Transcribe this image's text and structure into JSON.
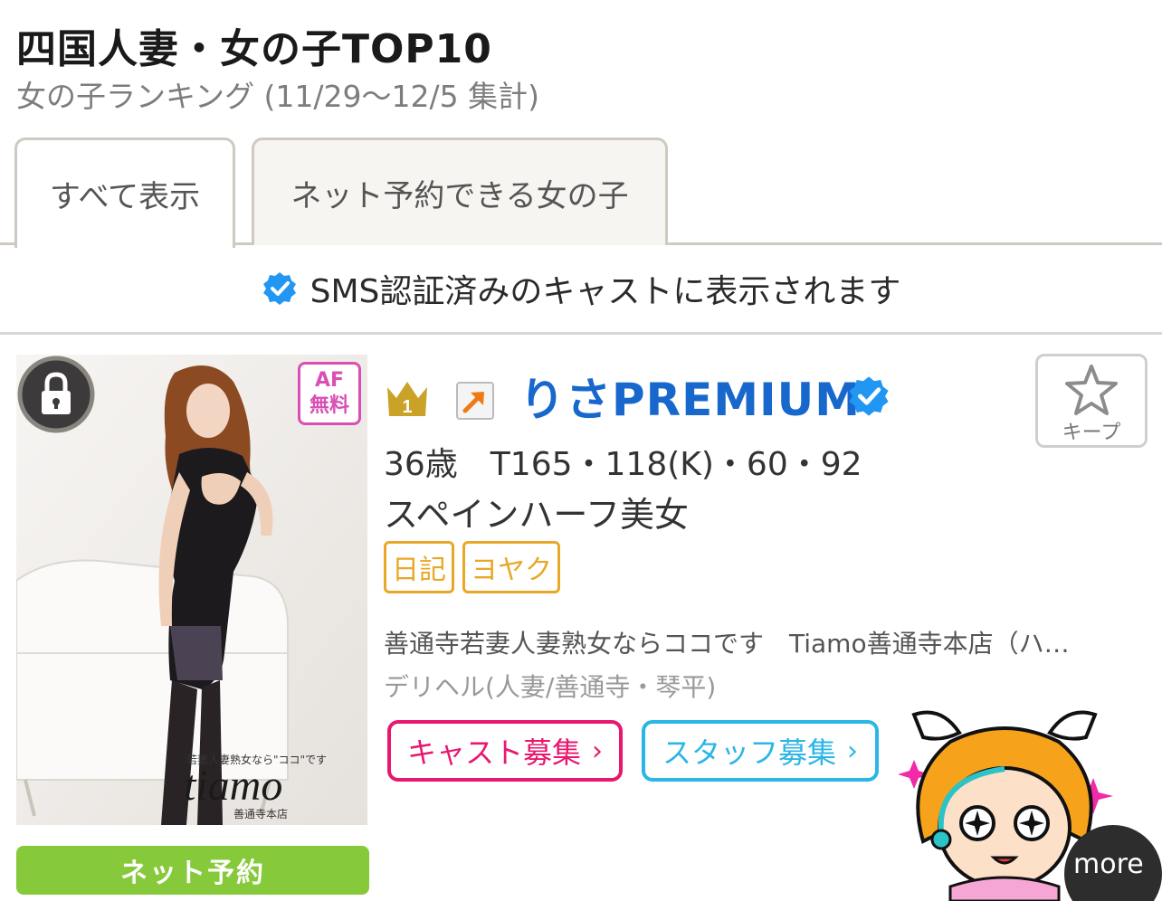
{
  "header": {
    "title": "四国人妻・女の子TOP10",
    "subtitle": "女の子ランキング (11/29〜12/5 集計)"
  },
  "tabs": [
    {
      "label": "すべて表示",
      "active": true
    },
    {
      "label": "ネット予約できる女の子",
      "active": false
    }
  ],
  "sms_note": "SMS認証済みのキャストに表示されます",
  "cast": {
    "rank": "1",
    "name": "りさPREMIUM",
    "specs": "36歳　T165・118(K)・60・92",
    "catch": "スペインハーフ美女",
    "tags": [
      "日記",
      "ヨヤク"
    ],
    "shop": "善通寺若妻人妻熟女ならココです　Tiamo善通寺本店（ハ…",
    "category": "デリヘル(人妻/善通寺・琴平)",
    "af_badge_line1": "AF",
    "af_badge_line2": "無料",
    "photo_caption": "tiamo",
    "photo_caption_top": "若妻人妻熟女なら\"ココ\"です",
    "photo_caption_bottom": "善通寺本店",
    "reserve_label": "ネット予約",
    "keep_label": "キープ"
  },
  "recruit": {
    "cast_label": "キャスト募集",
    "staff_label": "スタッフ募集",
    "chevron": "›"
  },
  "more_label": "more",
  "colors": {
    "name": "#1767cc",
    "verified": "#2196f3",
    "tag": "#e9a726",
    "cast_recruit": "#e8176f",
    "staff_recruit": "#2bb6e6",
    "reserve": "#86c93a"
  },
  "icons": [
    "verified-check-icon",
    "lock-icon",
    "crown-icon",
    "rank-up-arrow-icon",
    "star-icon"
  ]
}
